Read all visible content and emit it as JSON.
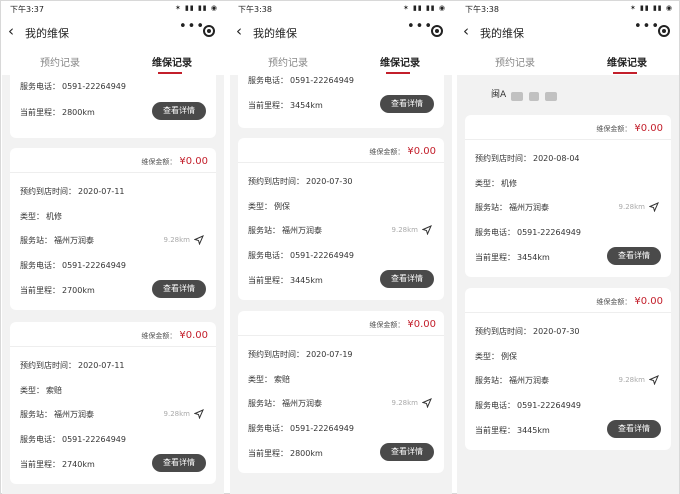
{
  "screens": [
    {
      "status_time": "下午3:37",
      "status_icons": "✶ ▮▮ ▮▮ ◉",
      "nav_title": "我的维保",
      "tabs": [
        "预约记录",
        "维保记录"
      ],
      "cards": [
        {
          "amount_label": "",
          "amount": "",
          "fields": [
            {
              "label": "服务电话：",
              "value": "0591-22264949"
            },
            {
              "label": "当前里程：",
              "value": "2800km"
            }
          ],
          "button": "查看详情"
        },
        {
          "amount_label": "维保金额：",
          "amount": "¥0.00",
          "fields": [
            {
              "label": "预约到店时间：",
              "value": "2020-07-11"
            },
            {
              "label": "类型：",
              "value": "机修"
            },
            {
              "label": "服务站：",
              "value": "福州万润泰",
              "distance": "9.28km"
            },
            {
              "label": "服务电话：",
              "value": "0591-22264949"
            },
            {
              "label": "当前里程：",
              "value": "2700km"
            }
          ],
          "button": "查看详情"
        },
        {
          "amount_label": "维保金额：",
          "amount": "¥0.00",
          "fields": [
            {
              "label": "预约到店时间：",
              "value": "2020-07-11"
            },
            {
              "label": "类型：",
              "value": "索赔"
            },
            {
              "label": "服务站：",
              "value": "福州万润泰",
              "distance": "9.28km"
            },
            {
              "label": "服务电话：",
              "value": "0591-22264949"
            },
            {
              "label": "当前里程：",
              "value": "2740km"
            }
          ],
          "button": "查看详情"
        }
      ]
    },
    {
      "status_time": "下午3:38",
      "status_icons": "✶ ▮▮ ▮▮ ◉",
      "nav_title": "我的维保",
      "tabs": [
        "预约记录",
        "维保记录"
      ],
      "cards": [
        {
          "amount_label": "",
          "amount": "",
          "fields": [
            {
              "label": "服务电话：",
              "value": "0591-22264949"
            },
            {
              "label": "当前里程：",
              "value": "3454km"
            }
          ],
          "button": "查看详情"
        },
        {
          "amount_label": "维保金额：",
          "amount": "¥0.00",
          "fields": [
            {
              "label": "预约到店时间：",
              "value": "2020-07-30"
            },
            {
              "label": "类型：",
              "value": "例保"
            },
            {
              "label": "服务站：",
              "value": "福州万润泰",
              "distance": "9.28km"
            },
            {
              "label": "服务电话：",
              "value": "0591-22264949"
            },
            {
              "label": "当前里程：",
              "value": "3445km"
            }
          ],
          "button": "查看详情"
        },
        {
          "amount_label": "维保金额：",
          "amount": "¥0.00",
          "fields": [
            {
              "label": "预约到店时间：",
              "value": "2020-07-19"
            },
            {
              "label": "类型：",
              "value": "索赔"
            },
            {
              "label": "服务站：",
              "value": "福州万润泰",
              "distance": "9.28km"
            },
            {
              "label": "服务电话：",
              "value": "0591-22264949"
            },
            {
              "label": "当前里程：",
              "value": "2800km"
            }
          ],
          "button": "查看详情"
        }
      ]
    },
    {
      "status_time": "下午3:38",
      "status_icons": "✶ ▮▮ ▮▮ ◉",
      "nav_title": "我的维保",
      "tabs": [
        "预约记录",
        "维保记录"
      ],
      "redacted_text": "闽A",
      "cards": [
        {
          "amount_label": "维保金额：",
          "amount": "¥0.00",
          "fields": [
            {
              "label": "预约到店时间：",
              "value": "2020-08-04"
            },
            {
              "label": "类型：",
              "value": "机修"
            },
            {
              "label": "服务站：",
              "value": "福州万润泰",
              "distance": "9.28km"
            },
            {
              "label": "服务电话：",
              "value": "0591-22264949"
            },
            {
              "label": "当前里程：",
              "value": "3454km"
            }
          ],
          "button": "查看详情"
        },
        {
          "amount_label": "维保金额：",
          "amount": "¥0.00",
          "fields": [
            {
              "label": "预约到店时间：",
              "value": "2020-07-30"
            },
            {
              "label": "类型：",
              "value": "例保"
            },
            {
              "label": "服务站：",
              "value": "福州万润泰",
              "distance": "9.28km"
            },
            {
              "label": "服务电话：",
              "value": "0591-22264949"
            },
            {
              "label": "当前里程：",
              "value": "3445km"
            }
          ],
          "button": "查看详情"
        }
      ]
    }
  ]
}
